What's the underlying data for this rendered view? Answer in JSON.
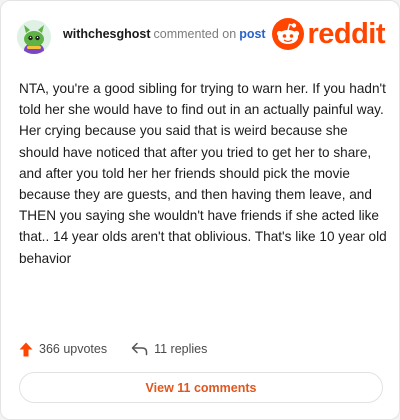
{
  "header": {
    "username": "withchesghost",
    "action_text": "commented on",
    "post_link": "post",
    "logo_text": "reddit",
    "avatar_icon": "snoo-avatar-icon",
    "logo_icon": "reddit-snoo-icon"
  },
  "comment": {
    "text": "NTA, you're a good sibling for trying to warn her. If you hadn't told her she would have to find out in an actually painful way. Her crying because you said that is weird because she should have noticed that after you tried to get her to share, and after you told her her friends should pick the movie because they are guests, and then having them leave, and THEN you saying she wouldn't have friends if she acted like that.. 14 year olds aren't that oblivious. That's like 10 year old behavior"
  },
  "stats": {
    "upvotes": "366 upvotes",
    "replies": "11 replies",
    "upvote_icon": "upvote-arrow-icon",
    "reply_icon": "reply-arrow-icon"
  },
  "button": {
    "view_comments": "View 11 comments"
  },
  "colors": {
    "brand": "#ff4500",
    "link": "#2a62c9",
    "button_text": "#e0561d"
  }
}
